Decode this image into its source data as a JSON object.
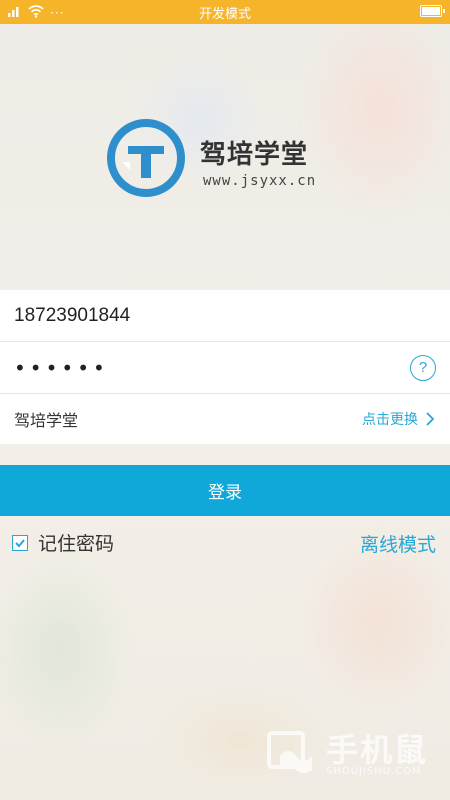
{
  "status_bar": {
    "title": "开发模式",
    "dots": "···"
  },
  "brand": {
    "name": "驾培学堂",
    "url": "www.jsyxx.cn",
    "colors": {
      "primary": "#2e8fcc"
    }
  },
  "form": {
    "phone": "18723901844",
    "password_mask": "••••••",
    "help_symbol": "?",
    "school": "驾培学堂",
    "change_label": "点击更换"
  },
  "login_button": {
    "label": "登录"
  },
  "options": {
    "remember_label": "记住密码",
    "remember_checked": true,
    "offline_label": "离线模式"
  },
  "watermark": {
    "text": "手机鼠",
    "sub": "SHOUJISHU.COM"
  },
  "colors": {
    "status_bar": "#f5b42a",
    "accent": "#29a7d6",
    "button": "#0fa8d8"
  }
}
